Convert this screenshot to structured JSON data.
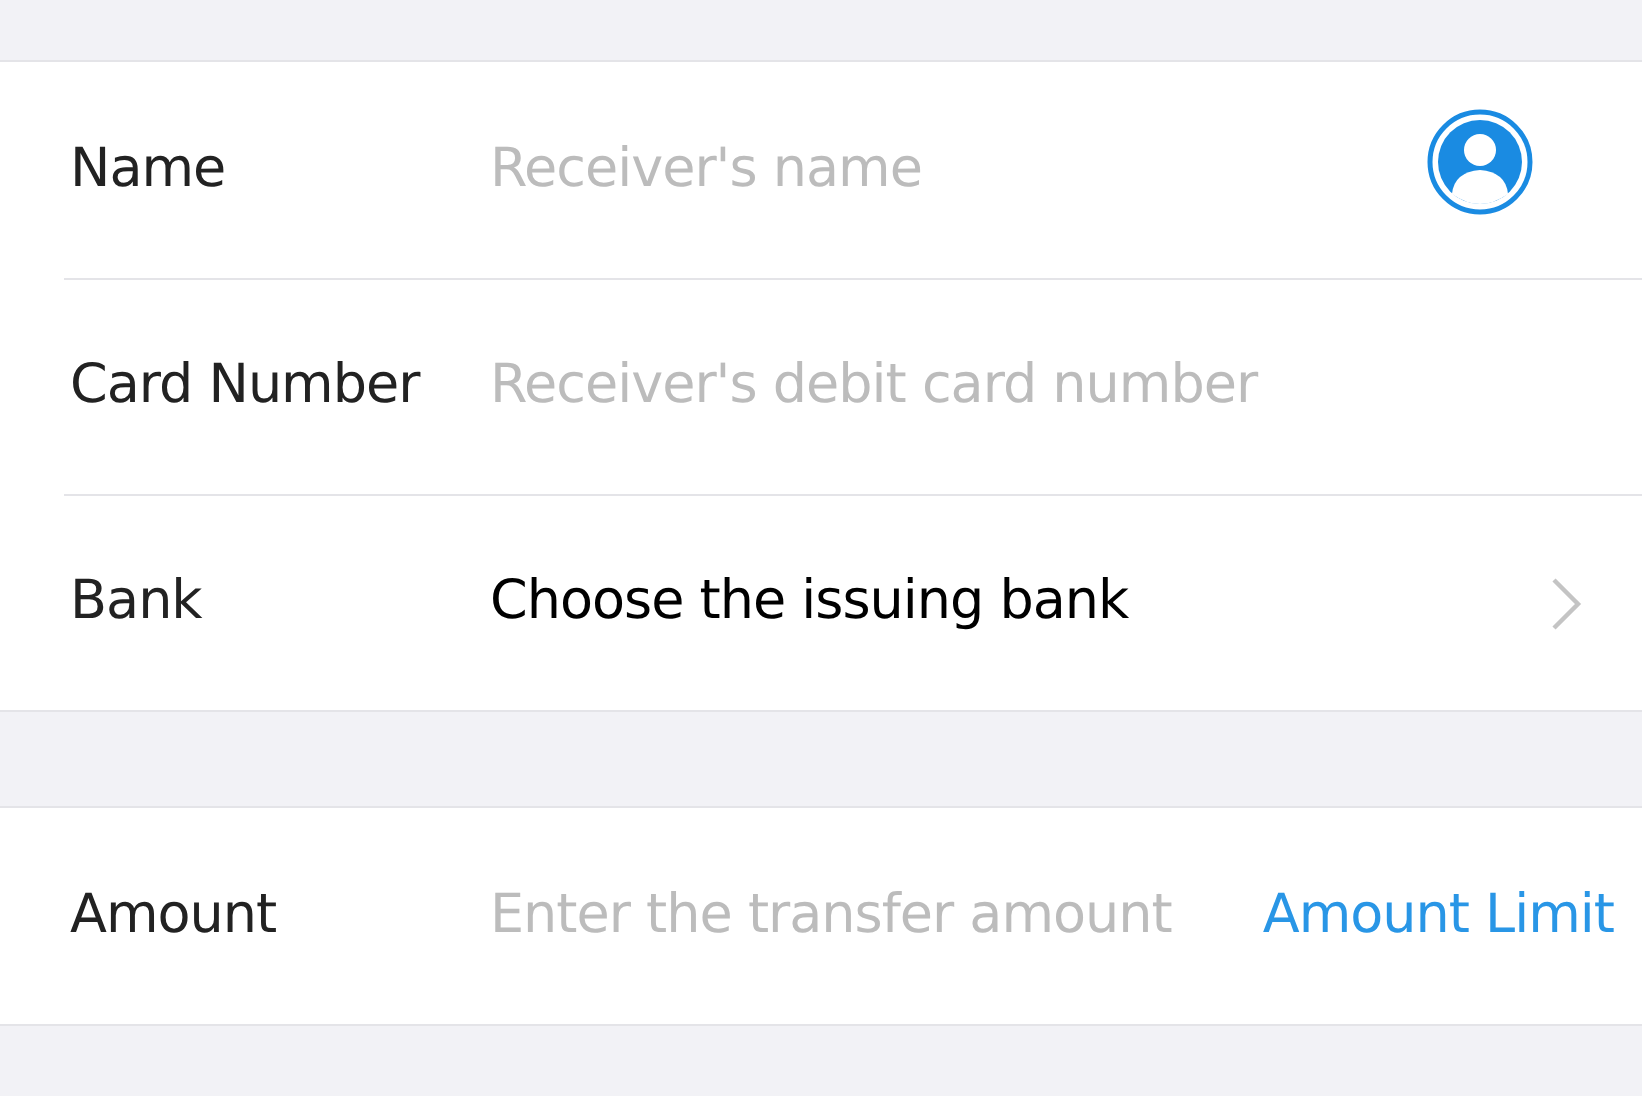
{
  "receiver_section": [
    {
      "kind": "input",
      "label": "Name",
      "placeholder": "Receiver's name",
      "contact_picker": true
    },
    {
      "kind": "input",
      "label": "Card Number",
      "placeholder": "Receiver's debit card number"
    },
    {
      "kind": "select",
      "label": "Bank",
      "value": "Choose the issuing bank"
    }
  ],
  "amount_section": [
    {
      "kind": "input",
      "label": "Amount",
      "placeholder": "Enter the transfer amount",
      "link": "Amount Limit"
    }
  ]
}
